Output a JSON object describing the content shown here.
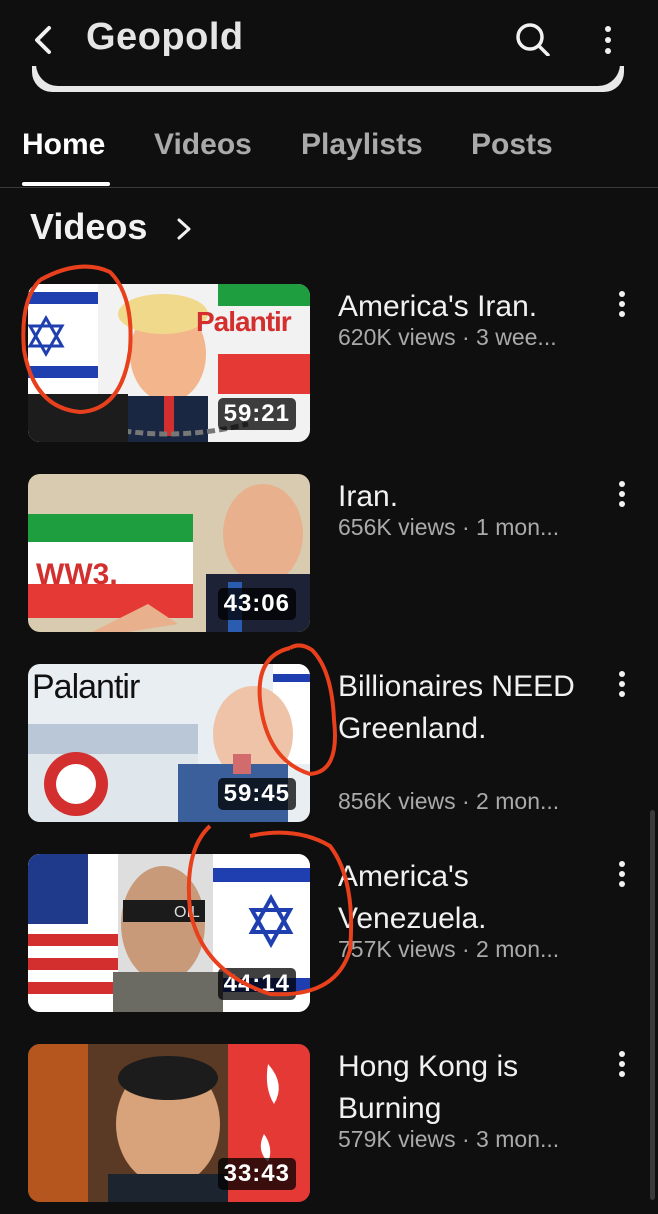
{
  "header": {
    "channel_title": "Geopold",
    "icons": {
      "back": "chevron-left-icon",
      "search": "search-icon",
      "more": "vertical-dots-icon"
    }
  },
  "tabs": [
    {
      "label": "Home",
      "active": true
    },
    {
      "label": "Videos",
      "active": false
    },
    {
      "label": "Playlists",
      "active": false
    },
    {
      "label": "Posts",
      "active": false
    }
  ],
  "section": {
    "title": "Videos"
  },
  "videos": [
    {
      "title": "America's Iran.",
      "meta": "620K views · 3 wee...",
      "duration": "59:21",
      "thumb_text": "Palantir"
    },
    {
      "title": "Iran.",
      "meta": "656K views · 1 mon...",
      "duration": "43:06",
      "thumb_text": "WW3."
    },
    {
      "title": "Billionaires NEED Greenland.",
      "meta": "856K views · 2 mon...",
      "duration": "59:45",
      "thumb_text": "Palantir"
    },
    {
      "title": "America's Venezuela.",
      "meta": "757K views · 2 mon...",
      "duration": "44:14",
      "thumb_text": "OIL"
    },
    {
      "title": "Hong Kong is Burning",
      "meta": "579K views · 3 mon...",
      "duration": "33:43",
      "thumb_text": ""
    }
  ],
  "colors": {
    "background": "#0f0f0f",
    "text": "#f1f1f1",
    "muted": "#aaaaaa",
    "annotation": "#e8401c"
  }
}
